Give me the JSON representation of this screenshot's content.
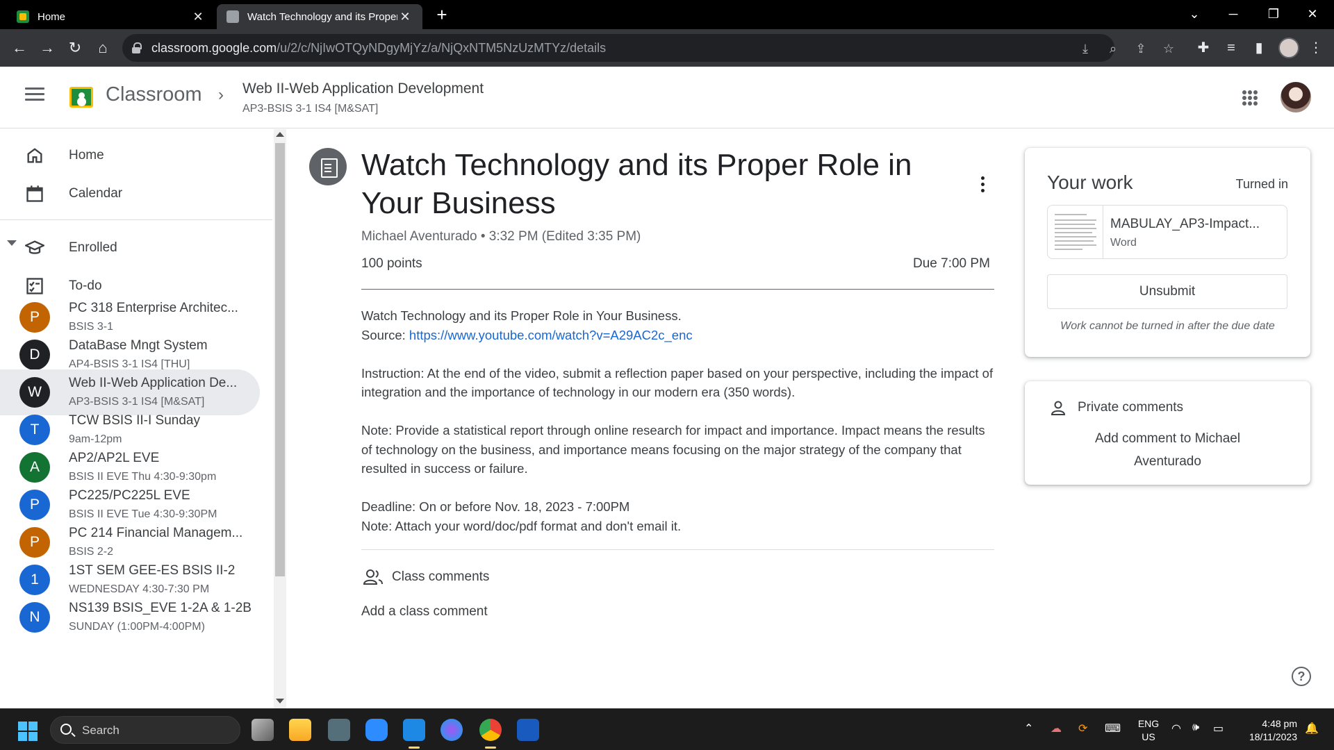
{
  "browser": {
    "tabs": [
      {
        "title": "Home"
      },
      {
        "title": "Watch Technology and its Proper Role in Your Business"
      }
    ],
    "new_tab": "+",
    "url_host": "classroom.google.com",
    "url_path": "/u/2/c/NjIwOTQyNDgyMjYz/a/NjQxNTM5NzUzMTYz/details"
  },
  "header": {
    "app_name": "Classroom",
    "course_title": "Web II-Web Application Development",
    "course_section": "AP3-BSIS 3-1 IS4 [M&SAT]"
  },
  "sidebar": {
    "top_items": [
      {
        "label": "Home",
        "icon": "home-icon"
      },
      {
        "label": "Calendar",
        "icon": "calendar-icon"
      }
    ],
    "enrolled_label": "Enrolled",
    "todo_label": "To-do",
    "courses": [
      {
        "initial": "P",
        "name": "PC 318 Enterprise Architec...",
        "sub": "BSIS 3-1",
        "color": "#c26401"
      },
      {
        "initial": "D",
        "name": "DataBase Mngt System",
        "sub": "AP4-BSIS 3-1 IS4 [THU]",
        "color": "#202124"
      },
      {
        "initial": "W",
        "name": "Web II-Web Application De...",
        "sub": "AP3-BSIS 3-1 IS4 [M&SAT]",
        "color": "#202124"
      },
      {
        "initial": "T",
        "name": "TCW BSIS II-I Sunday",
        "sub": "9am-12pm",
        "color": "#1967d2"
      },
      {
        "initial": "A",
        "name": "AP2/AP2L EVE",
        "sub": "BSIS II EVE Thu 4:30-9:30pm",
        "color": "#137333"
      },
      {
        "initial": "P",
        "name": "PC225/PC225L EVE",
        "sub": "BSIS II EVE Tue 4:30-9:30PM",
        "color": "#1967d2"
      },
      {
        "initial": "P",
        "name": "PC 214 Financial Managem...",
        "sub": "BSIS 2-2",
        "color": "#c26401"
      },
      {
        "initial": "1",
        "name": "1ST SEM GEE-ES BSIS II-2",
        "sub": "WEDNESDAY 4:30-7:30 PM",
        "color": "#1967d2"
      },
      {
        "initial": "N",
        "name": "NS139 BSIS_EVE 1-2A & 1-2B",
        "sub": "SUNDAY (1:00PM-4:00PM)",
        "color": "#1967d2"
      }
    ]
  },
  "assignment": {
    "title": "Watch Technology and its Proper Role in Your Business",
    "author": "Michael Aventurado",
    "time": "3:32 PM (Edited 3:35 PM)",
    "points": "100 points",
    "due": "Due 7:00 PM",
    "line1": "Watch Technology and its Proper Role in Your Business.",
    "source_label": "Source: ",
    "source_url": "https://www.youtube.com/watch?v=A29AC2c_enc",
    "instruction": "Instruction:   At the end of the video, submit a reflection paper based on your perspective, including the impact of integration and the importance of technology in our modern era (350 words).",
    "note1": "Note:  Provide a statistical report through online research for impact and importance. Impact means the results of technology on the business, and importance means focusing on the major strategy of the company that resulted in success or failure.",
    "deadline": "Deadline: On or before Nov. 18, 2023 - 7:00PM",
    "note2": "Note: Attach your word/doc/pdf format and don't email it.",
    "class_comments_label": "Class comments",
    "add_class_comment": "Add a class comment"
  },
  "your_work": {
    "title": "Your work",
    "status": "Turned in",
    "attachment_name": "MABULAY_AP3-Impact...",
    "attachment_type": "Word",
    "unsubmit_label": "Unsubmit",
    "note": "Work cannot be turned in after the due date"
  },
  "private_comments": {
    "label": "Private comments",
    "add": "Add comment to Michael Aventurado"
  },
  "taskbar": {
    "search_placeholder": "Search",
    "lang_top": "ENG",
    "lang_bottom": "US",
    "time": "4:48 pm",
    "date": "18/11/2023"
  }
}
